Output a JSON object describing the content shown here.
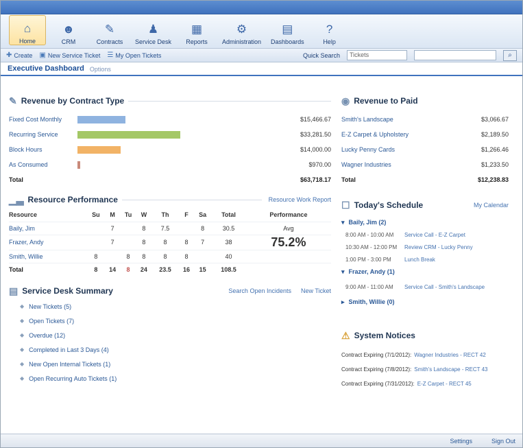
{
  "ribbon": {
    "buttons": [
      {
        "label": "Home",
        "icon": "home-icon"
      },
      {
        "label": "CRM",
        "icon": "users-icon"
      },
      {
        "label": "Contracts",
        "icon": "pen-icon"
      },
      {
        "label": "Service Desk",
        "icon": "person-icon"
      },
      {
        "label": "Reports",
        "icon": "chart-icon"
      },
      {
        "label": "Administration",
        "icon": "gear-icon"
      },
      {
        "label": "Dashboards",
        "icon": "dashboard-icon"
      },
      {
        "label": "Help",
        "icon": "help-icon"
      }
    ]
  },
  "quickbar": {
    "links": [
      {
        "label": "Create",
        "icon": "plus-icon"
      },
      {
        "label": "New Service Ticket",
        "icon": "ticket-icon"
      },
      {
        "label": "My Open Tickets",
        "icon": "list-icon"
      }
    ],
    "search_label": "Quick Search",
    "search_select": "Tickets",
    "search_button": "Go"
  },
  "page": {
    "title": "Executive Dashboard",
    "subtitle": "Options"
  },
  "revenue_by_contract": {
    "title": "Revenue by Contract Type",
    "rows": [
      {
        "label": "Fixed Cost Monthly",
        "value": "$15,466.67"
      },
      {
        "label": "Recurring Service",
        "value": "$33,281.50"
      },
      {
        "label": "Block Hours",
        "value": "$14,000.00"
      },
      {
        "label": "As Consumed",
        "value": "$970.00"
      }
    ],
    "total": {
      "label": "Total",
      "value": "$63,718.17"
    }
  },
  "chart_data": {
    "type": "bar",
    "categories": [
      "Fixed Cost Monthly",
      "Recurring Service",
      "Block Hours",
      "As Consumed"
    ],
    "values": [
      15466.67,
      33281.5,
      14000,
      970
    ],
    "colors": [
      "#8fb3e0",
      "#a4c866",
      "#f2b366",
      "#c98a7a"
    ]
  },
  "resource_performance": {
    "title": "Resource Performance",
    "link": "Resource Work Report",
    "headers": [
      "Resource",
      "Su",
      "M",
      "Tu",
      "W",
      "Th",
      "F",
      "Sa",
      "Total",
      "Performance"
    ],
    "rows": [
      {
        "cells": [
          "Baily, Jim",
          "",
          "7",
          "",
          "8",
          "7.5",
          "",
          "8",
          "30.5"
        ]
      },
      {
        "cells": [
          "Frazer, Andy",
          "",
          "7",
          "",
          "8",
          "8",
          "8",
          "7",
          "38"
        ]
      },
      {
        "cells": [
          "Smith, Willie",
          "8",
          "",
          "8",
          "8",
          "8",
          "8",
          "",
          "40"
        ]
      }
    ],
    "total": {
      "cells": [
        "Total",
        "8",
        "14",
        "8",
        "24",
        "23.5",
        "16",
        "15",
        "108.5"
      ]
    },
    "performance_label": "Avg",
    "performance_value": "75.2%"
  },
  "service_desk": {
    "title": "Service Desk Summary",
    "links": [
      "Search Open Incidents",
      "New Ticket"
    ],
    "items": [
      "New Tickets (5)",
      "Open Tickets (7)",
      "Overdue (12)",
      "Completed in Last 3 Days (4)",
      "New Open Internal Tickets (1)",
      "Open Recurring Auto Tickets (1)"
    ]
  },
  "revenue_to_paid": {
    "title": "Revenue to Paid",
    "rows": [
      {
        "label": "Smith's Landscape",
        "value": "$3,066.67"
      },
      {
        "label": "E-Z Carpet & Upholstery",
        "value": "$2,189.50"
      },
      {
        "label": "Lucky Penny Cards",
        "value": "$1,266.46"
      },
      {
        "label": "Wagner Industries",
        "value": "$1,233.50"
      }
    ],
    "total": {
      "label": "Total",
      "value": "$12,238.83"
    }
  },
  "schedule": {
    "title": "Today's Schedule",
    "link": "My Calendar",
    "groups": [
      {
        "name": "Baily, Jim (2)",
        "events": [
          {
            "time": "8:00 AM - 10:00 AM",
            "text": "Service Call - E-Z Carpet"
          },
          {
            "time": "10:30 AM - 12:00 PM",
            "text": "Review CRM - Lucky Penny"
          },
          {
            "time": "1:00 PM - 3:00 PM",
            "text": "Lunch Break"
          }
        ]
      },
      {
        "name": "Frazer, Andy (1)",
        "events": [
          {
            "time": "9:00 AM - 11:00 AM",
            "text": "Service Call - Smith's Landscape"
          }
        ]
      },
      {
        "name": "Smith, Willie (0)",
        "events": []
      }
    ]
  },
  "system_notices": {
    "title": "System Notices",
    "rows": [
      {
        "text": "Contract Expiring (7/1/2012):",
        "link": "Wagner Industries - RECT 42"
      },
      {
        "text": "Contract Expiring (7/8/2012):",
        "link": "Smith's Landscape - RECT 43"
      },
      {
        "text": "Contract Expiring (7/31/2012):",
        "link": "E-Z Carpet - RECT 45"
      }
    ]
  },
  "statusbar": {
    "left": "Settings",
    "right": "Sign Out"
  }
}
